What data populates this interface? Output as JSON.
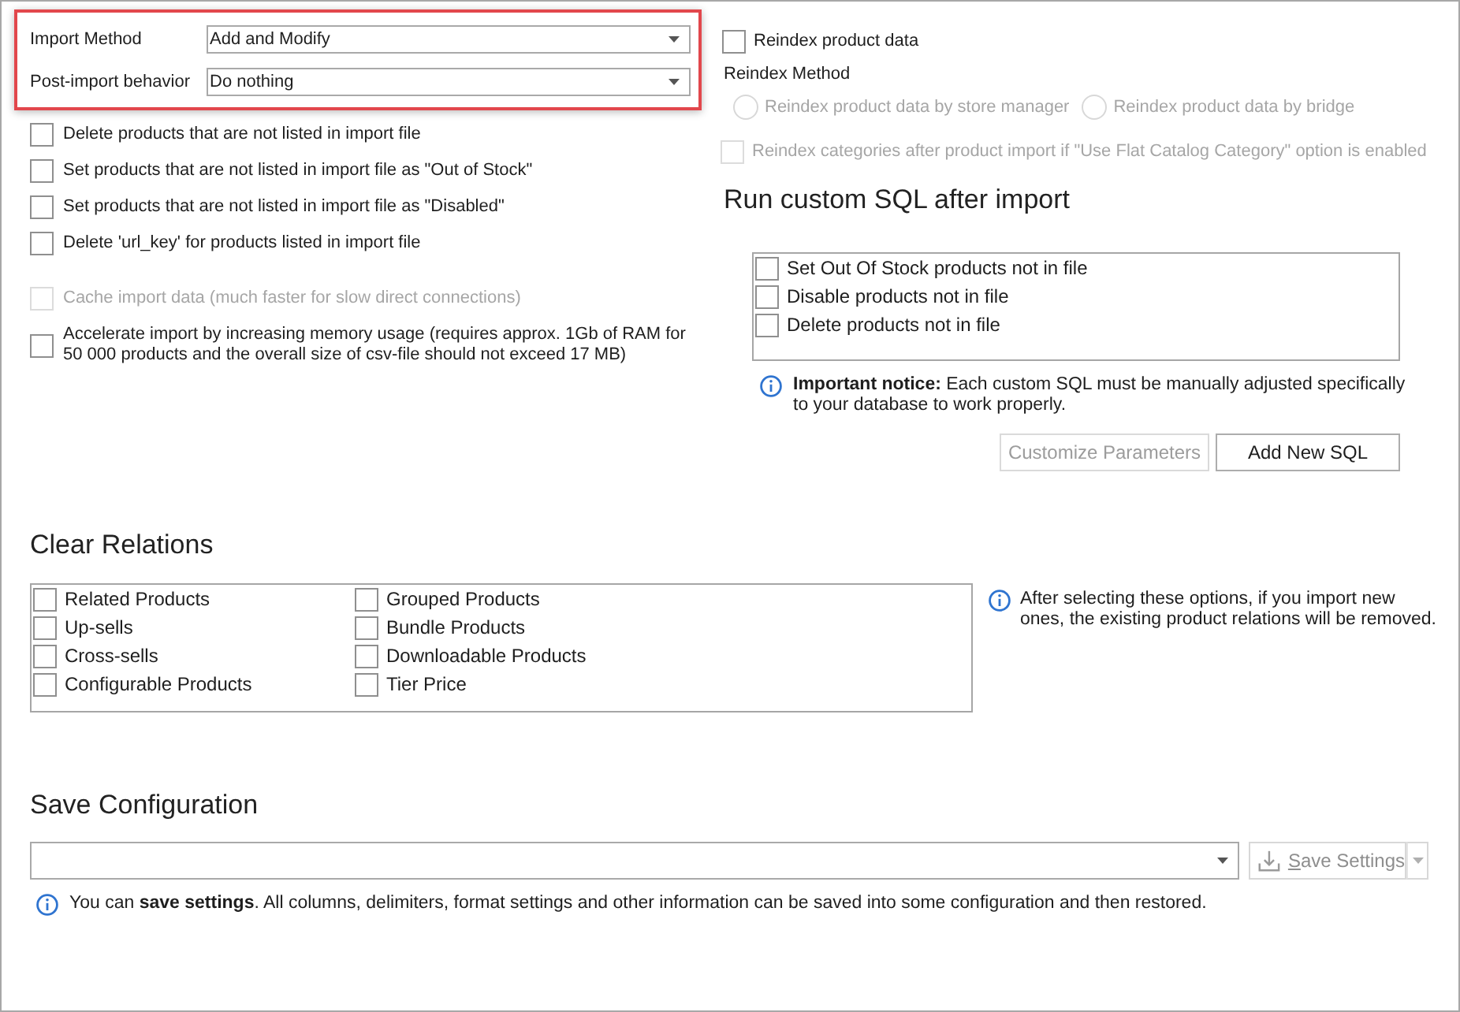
{
  "import_settings": {
    "highlighted": true,
    "fields": [
      {
        "label": "Import Method",
        "value": "Add and Modify"
      },
      {
        "label": "Post-import behavior",
        "value": "Do nothing"
      }
    ]
  },
  "import_options": [
    {
      "label": "Delete products that are not listed in import file",
      "checked": false,
      "disabled": false
    },
    {
      "label": "Set products that are not listed in import file as \"Out of Stock\"",
      "checked": false,
      "disabled": false
    },
    {
      "label": "Set products that are not listed in import file as \"Disabled\"",
      "checked": false,
      "disabled": false
    },
    {
      "label": "Delete 'url_key' for products listed in import file",
      "checked": false,
      "disabled": false
    }
  ],
  "performance_options": [
    {
      "label": "Cache import data (much faster for slow direct connections)",
      "checked": false,
      "disabled": true
    },
    {
      "label": "Accelerate import by increasing memory usage (requires approx. 1Gb of RAM for 50 000 products and the overall size of csv-file should not exceed 17 MB)",
      "checked": false,
      "disabled": false
    }
  ],
  "reindex": {
    "product_data": {
      "label": "Reindex product data",
      "checked": false
    },
    "method_label": "Reindex Method",
    "methods": [
      {
        "label": "Reindex product data by store manager",
        "selected": false,
        "disabled": true
      },
      {
        "label": "Reindex product data by bridge",
        "selected": false,
        "disabled": true
      }
    ],
    "categories": {
      "label": "Reindex categories after product import if \"Use Flat Catalog Category\" option is enabled",
      "checked": false,
      "disabled": true
    }
  },
  "custom_sql": {
    "title": "Run custom SQL after import",
    "items": [
      {
        "label": "Set Out Of Stock products not in file",
        "checked": false
      },
      {
        "label": "Disable products not in file",
        "checked": false
      },
      {
        "label": "Delete products not in file",
        "checked": false
      }
    ],
    "notice": "**Important notice:** Each custom SQL must be manually adjusted specifically to your database to work properly.",
    "buttons": [
      {
        "label": "Customize Parameters",
        "disabled": true
      },
      {
        "label": "Add New SQL",
        "disabled": false
      }
    ]
  },
  "clear_relations": {
    "title": "Clear Relations",
    "columns": [
      [
        {
          "label": "Related Products",
          "checked": false
        },
        {
          "label": "Up-sells",
          "checked": false
        },
        {
          "label": "Cross-sells",
          "checked": false
        },
        {
          "label": "Configurable Products",
          "checked": false
        }
      ],
      [
        {
          "label": "Grouped Products",
          "checked": false
        },
        {
          "label": "Bundle Products",
          "checked": false
        },
        {
          "label": "Downloadable Products",
          "checked": false
        },
        {
          "label": "Tier Price",
          "checked": false
        }
      ]
    ],
    "notice": "After selecting these options, if you import new ones, the existing product relations will be removed."
  },
  "save_configuration": {
    "title": "Save Configuration",
    "save_button": {
      "label": "Save Settings",
      "disabled": true
    },
    "notice": "You can **save settings**. All columns, delimiters, format settings and other information can be saved into some configuration and then restored."
  }
}
